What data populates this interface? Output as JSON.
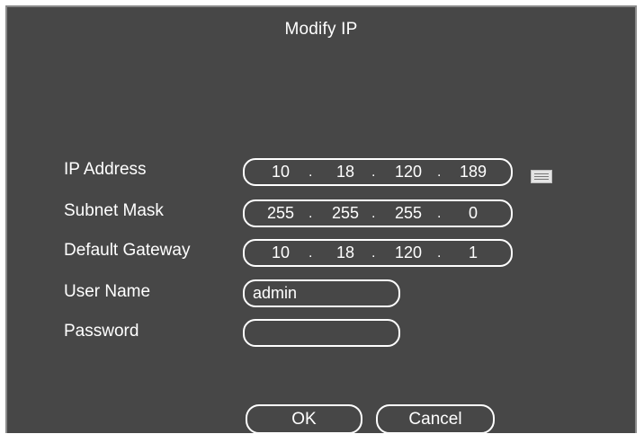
{
  "dialog": {
    "title": "Modify IP"
  },
  "fields": {
    "ip_address": {
      "label": "IP Address",
      "octets": [
        "10",
        "18",
        "120",
        "189"
      ]
    },
    "subnet_mask": {
      "label": "Subnet Mask",
      "octets": [
        "255",
        "255",
        "255",
        "0"
      ]
    },
    "default_gateway": {
      "label": "Default Gateway",
      "octets": [
        "10",
        "18",
        "120",
        "1"
      ]
    },
    "user_name": {
      "label": "User Name",
      "value": "admin"
    },
    "password": {
      "label": "Password",
      "value": ""
    }
  },
  "separator": ".",
  "buttons": {
    "ok": "OK",
    "cancel": "Cancel"
  },
  "icons": {
    "keyboard": "keyboard-icon"
  },
  "colors": {
    "background": "#474747",
    "text": "#ffffff",
    "border": "#ffffff"
  }
}
